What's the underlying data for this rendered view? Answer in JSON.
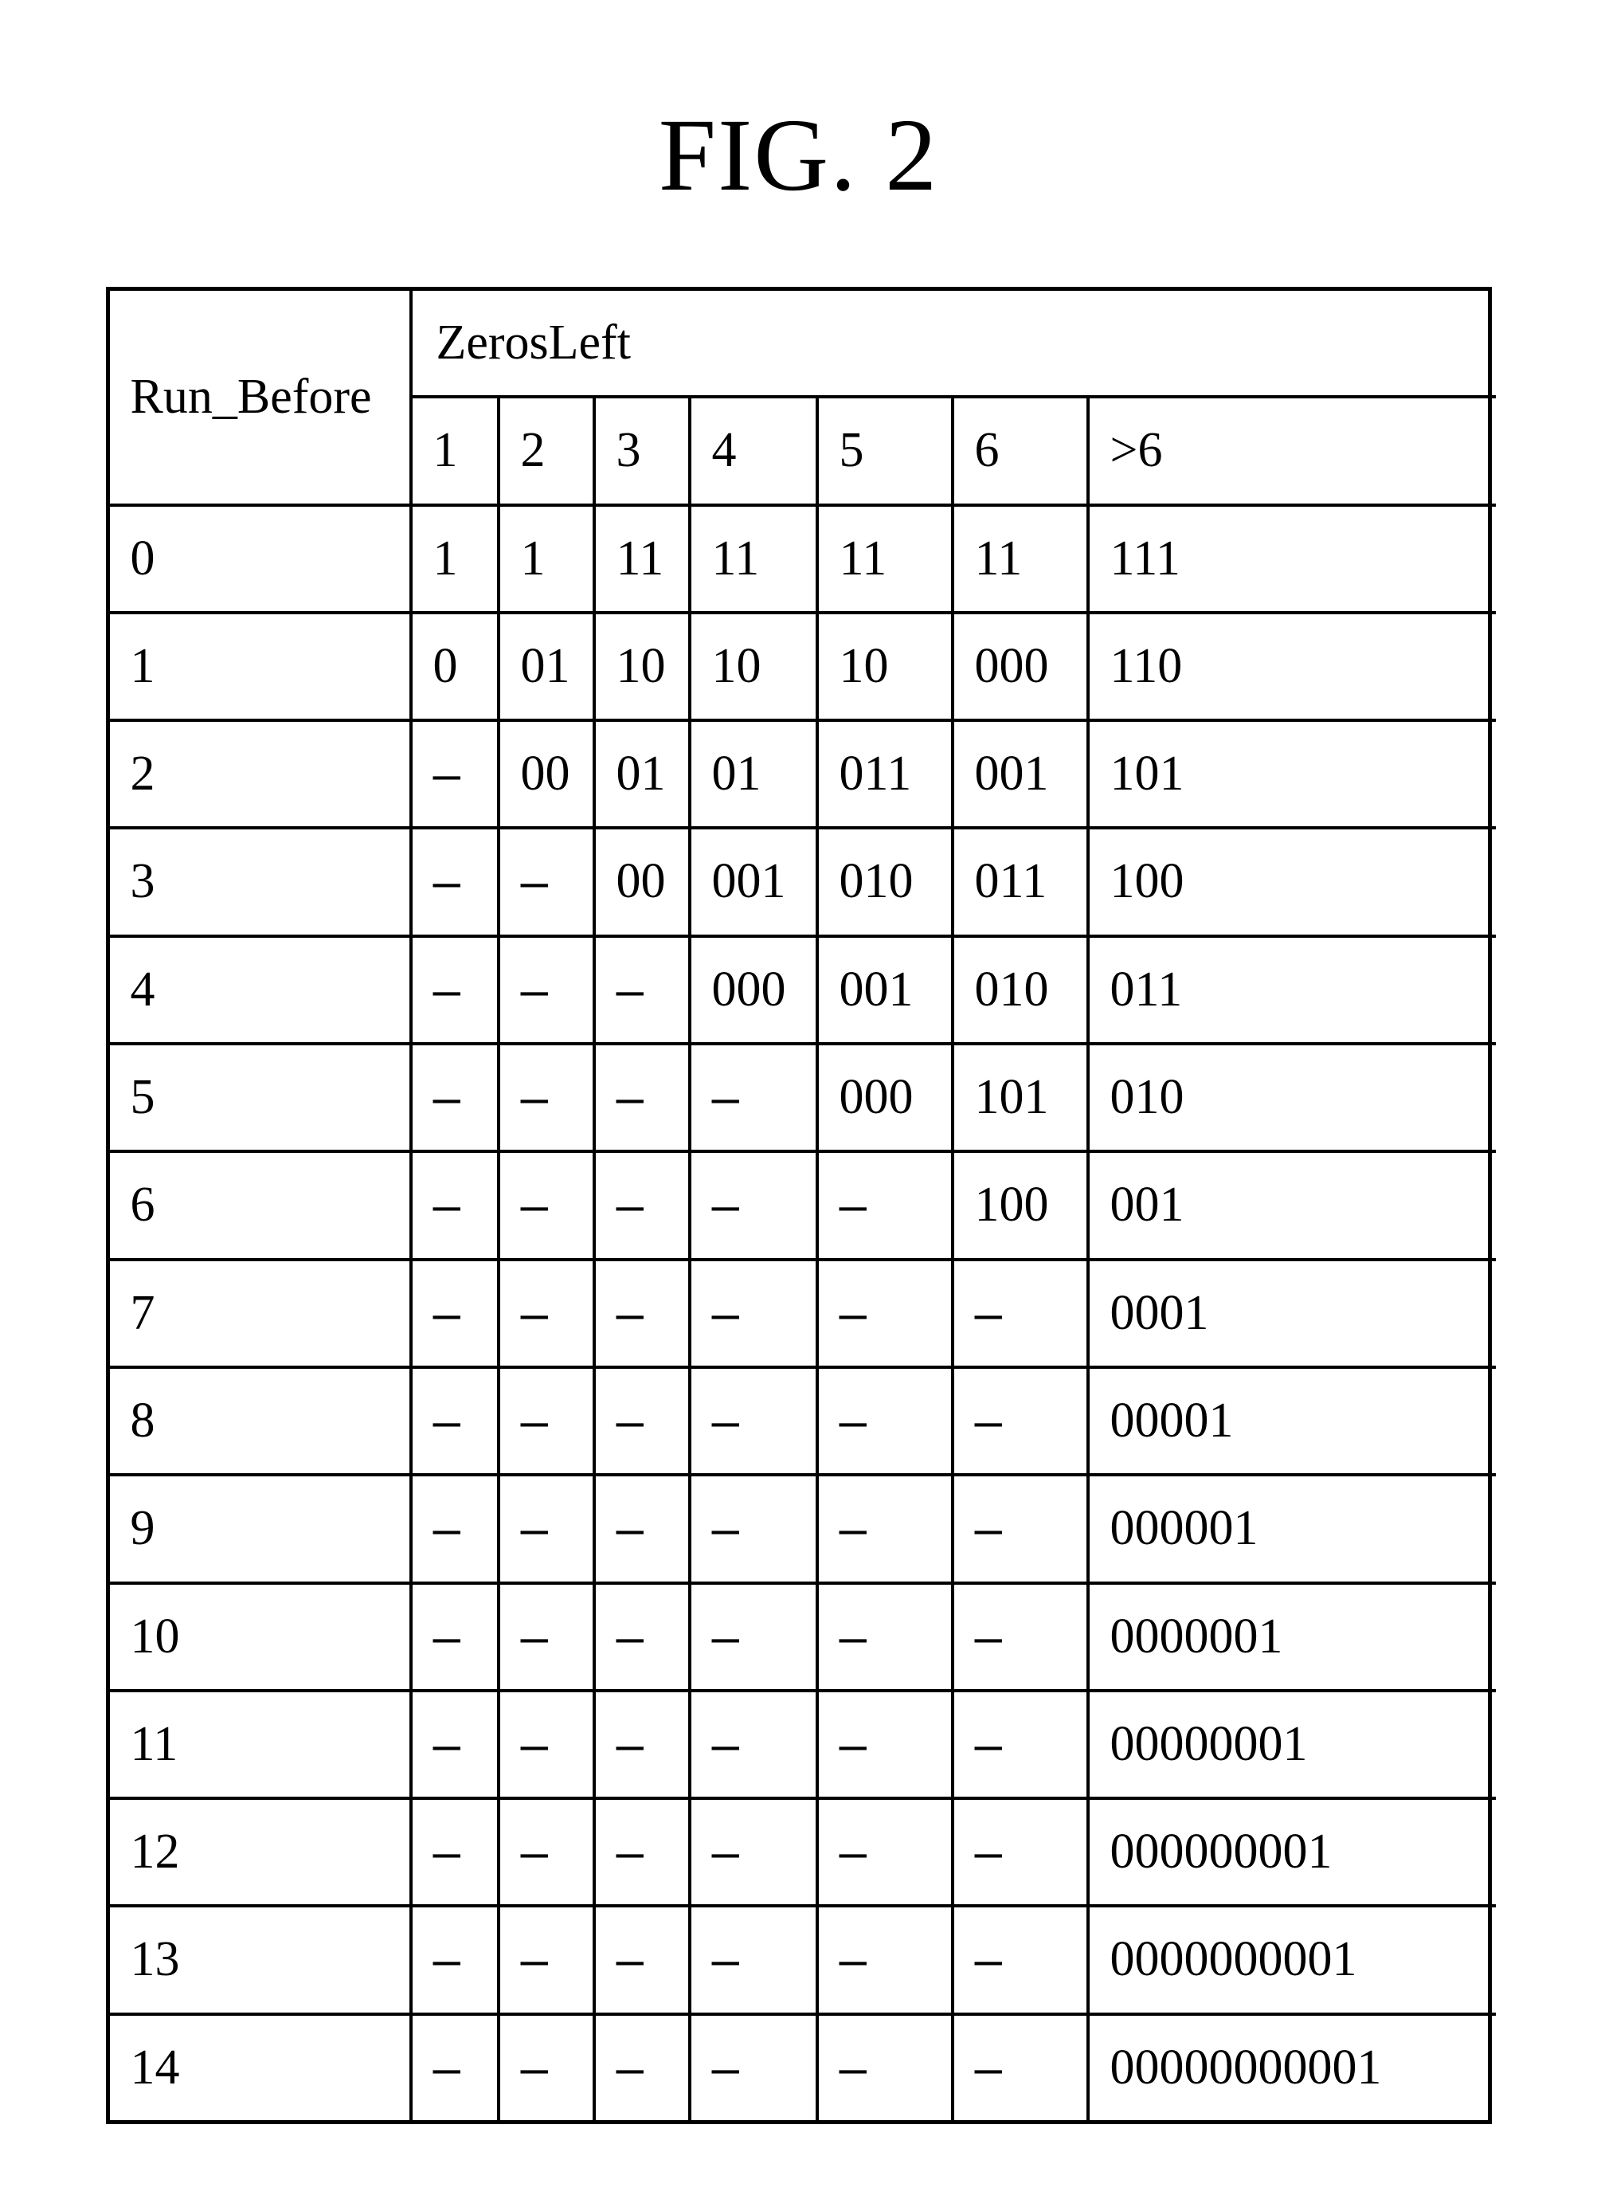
{
  "title": "FIG. 2",
  "row_header": "Run_Before",
  "col_group_header": "ZerosLeft",
  "col_headers": [
    "1",
    "2",
    "3",
    "4",
    "5",
    "6",
    ">6"
  ],
  "rows": [
    {
      "label": "0",
      "cells": [
        "1",
        "1",
        "11",
        "11",
        "11",
        "11",
        "111"
      ]
    },
    {
      "label": "1",
      "cells": [
        "0",
        "01",
        "10",
        "10",
        "10",
        "000",
        "110"
      ]
    },
    {
      "label": "2",
      "cells": [
        "–",
        "00",
        "01",
        "01",
        "011",
        "001",
        "101"
      ]
    },
    {
      "label": "3",
      "cells": [
        "–",
        "–",
        "00",
        "001",
        "010",
        "011",
        "100"
      ]
    },
    {
      "label": "4",
      "cells": [
        "–",
        "–",
        "–",
        "000",
        "001",
        "010",
        "011"
      ]
    },
    {
      "label": "5",
      "cells": [
        "–",
        "–",
        "–",
        "–",
        "000",
        "101",
        "010"
      ]
    },
    {
      "label": "6",
      "cells": [
        "–",
        "–",
        "–",
        "–",
        "–",
        "100",
        "001"
      ]
    },
    {
      "label": "7",
      "cells": [
        "–",
        "–",
        "–",
        "–",
        "–",
        "–",
        "0001"
      ]
    },
    {
      "label": "8",
      "cells": [
        "–",
        "–",
        "–",
        "–",
        "–",
        "–",
        "00001"
      ]
    },
    {
      "label": "9",
      "cells": [
        "–",
        "–",
        "–",
        "–",
        "–",
        "–",
        "000001"
      ]
    },
    {
      "label": "10",
      "cells": [
        "–",
        "–",
        "–",
        "–",
        "–",
        "–",
        "0000001"
      ]
    },
    {
      "label": "11",
      "cells": [
        "–",
        "–",
        "–",
        "–",
        "–",
        "–",
        "00000001"
      ]
    },
    {
      "label": "12",
      "cells": [
        "–",
        "–",
        "–",
        "–",
        "–",
        "–",
        "000000001"
      ]
    },
    {
      "label": "13",
      "cells": [
        "–",
        "–",
        "–",
        "–",
        "–",
        "–",
        "0000000001"
      ]
    },
    {
      "label": "14",
      "cells": [
        "–",
        "–",
        "–",
        "–",
        "–",
        "–",
        "00000000001"
      ]
    }
  ]
}
